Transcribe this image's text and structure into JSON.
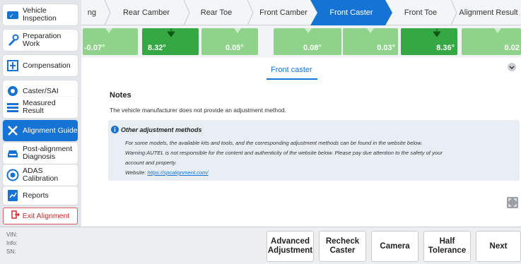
{
  "sidebar": {
    "items": [
      {
        "label": "Vehicle Inspection",
        "icon": "vehicle-inspection-icon"
      },
      {
        "label": "Preparation Work",
        "icon": "wrench-icon"
      },
      {
        "label": "Compensation",
        "icon": "compensation-icon"
      },
      {
        "label": "Caster/SAI",
        "icon": "wheel-icon"
      },
      {
        "label": "Measured Result",
        "icon": "list-icon"
      },
      {
        "label": "Alignment Guide",
        "icon": "tools-icon"
      },
      {
        "label": "Post-alignment Diagnosis",
        "icon": "car-icon"
      },
      {
        "label": "ADAS Calibration",
        "icon": "adas-icon"
      },
      {
        "label": "Reports",
        "icon": "report-icon"
      }
    ],
    "active_index": 5,
    "exit_label": "Exit Alignment"
  },
  "steps": {
    "items": [
      "ng",
      "Rear Camber",
      "Rear Toe",
      "Front Camber",
      "Front Caster",
      "Front Toe",
      "Alignment Result"
    ],
    "active": "Front Caster"
  },
  "gauges": {
    "values": [
      "-0.07°",
      "8.32°",
      "0.05°",
      "0.08°",
      "0.03°",
      "8.36°",
      "0.02"
    ]
  },
  "panel": {
    "tab_title": "Front caster",
    "notes_title": "Notes",
    "notes_text": "The vehicle manufacturer does not provide an adjustment method.",
    "other_title": "Other adjustment methods",
    "other_line1": "For some models, the available kits and tools, and the corresponding adjustment methods can be found in the website below.",
    "other_line2": "Warning:AUTEL is not responsible for the content and authenticity of the website below. Please pay due attention to the safety of your",
    "other_line3": "account and property.",
    "website_label": "Website: ",
    "website_url": "https://spcalignment.com/"
  },
  "bottom": {
    "vin_label": "VIN:",
    "info_label": "Info:",
    "sn_label": "SN:",
    "buttons": {
      "advanced_adjustment": "Advanced Adjustment",
      "recheck_caster": "Recheck Caster",
      "camera": "Camera",
      "half_tolerance": "Half Tolerance",
      "next": "Next"
    }
  },
  "colors": {
    "accent": "#1673d6",
    "gauge_green": "#8fd38a",
    "gauge_green_active": "#35a843",
    "exit_red": "#d12a2a"
  }
}
